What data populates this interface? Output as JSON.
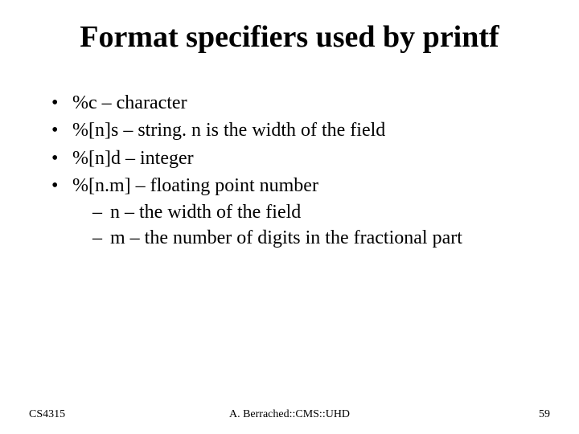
{
  "title": "Format specifiers used by printf",
  "bullets": [
    {
      "text": "%c – character"
    },
    {
      "text": "%[n]s – string. n is the width of the field"
    },
    {
      "text": "%[n]d – integer"
    },
    {
      "text": "%[n.m] – floating point number",
      "sub": [
        "n – the width of the field",
        "m – the number of digits in the fractional part"
      ]
    }
  ],
  "footer": {
    "left": "CS4315",
    "center": "A. Berrached::CMS::UHD",
    "right": "59"
  }
}
